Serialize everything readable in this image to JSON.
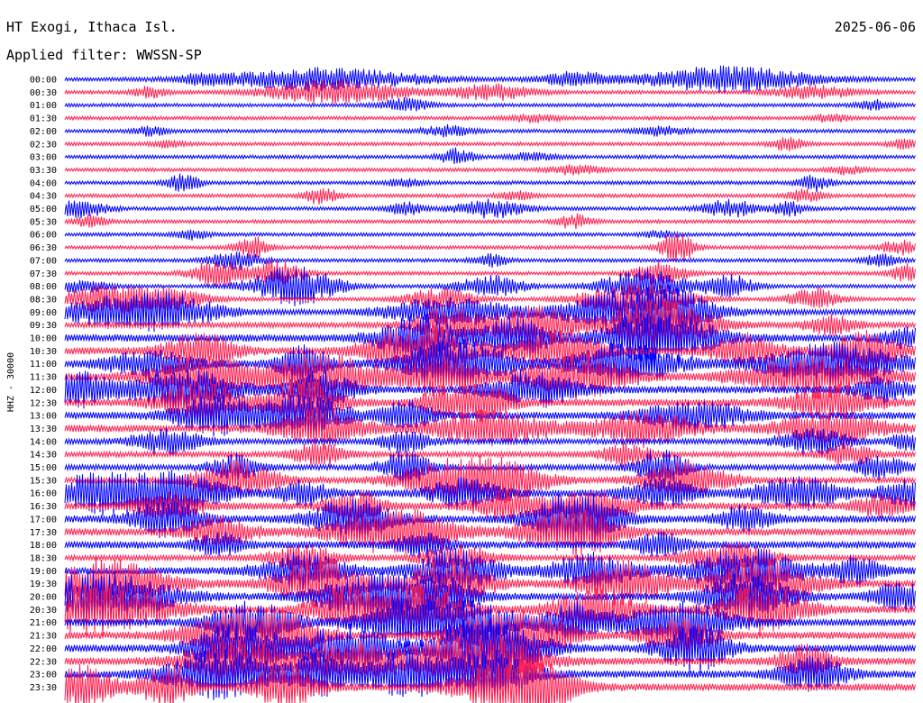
{
  "header": {
    "station": "HT Exogi, Ithaca Isl.",
    "date": "2025-06-06",
    "filter": "Applied filter: WWSSN-SP"
  },
  "chart_data": {
    "type": "line",
    "title": "HT Exogi, Ithaca Isl.",
    "subtitle": "Applied filter: WWSSN-SP",
    "date": "2025-06-06",
    "ylabel": "HHZ - 30000",
    "row_labels": [
      "00:00",
      "00:30",
      "01:00",
      "01:30",
      "02:00",
      "02:30",
      "03:00",
      "03:30",
      "04:00",
      "04:30",
      "05:00",
      "05:30",
      "06:00",
      "06:30",
      "07:00",
      "07:30",
      "08:00",
      "08:30",
      "09:00",
      "09:30",
      "10:00",
      "10:30",
      "11:00",
      "11:30",
      "12:00",
      "12:30",
      "13:00",
      "13:30",
      "14:00",
      "14:30",
      "15:00",
      "15:30",
      "16:00",
      "16:30",
      "17:00",
      "17:30",
      "18:00",
      "18:30",
      "19:00",
      "19:30",
      "20:00",
      "20:30",
      "21:00",
      "21:30",
      "22:00",
      "22:30",
      "23:00",
      "23:30"
    ],
    "row_colors": [
      "#0000ff",
      "#ff1e4f"
    ],
    "noise_level": [
      2,
      2,
      2,
      2,
      2,
      2,
      2,
      2,
      2,
      2,
      2,
      2,
      2,
      2,
      2,
      2,
      2,
      2,
      3,
      3,
      4,
      4,
      4,
      4,
      4,
      4,
      4,
      4,
      3,
      3,
      3,
      3,
      4,
      4,
      4,
      4,
      4,
      3,
      4,
      4,
      4,
      4,
      4,
      4,
      4,
      4,
      4,
      4
    ],
    "bursts": [
      [
        [
          0.3,
          0.12,
          12
        ],
        [
          0.6,
          0.04,
          8
        ],
        [
          0.78,
          0.1,
          14
        ],
        [
          0.16,
          0.02,
          5
        ]
      ],
      [
        [
          0.32,
          0.08,
          14
        ],
        [
          0.5,
          0.05,
          9
        ],
        [
          0.1,
          0.02,
          6
        ],
        [
          0.88,
          0.05,
          7
        ]
      ],
      [
        [
          0.4,
          0.03,
          7
        ],
        [
          0.95,
          0.02,
          5
        ]
      ],
      [
        [
          0.55,
          0.03,
          4
        ],
        [
          0.9,
          0.02,
          5
        ]
      ],
      [
        [
          0.1,
          0.02,
          5
        ],
        [
          0.45,
          0.03,
          6
        ],
        [
          0.7,
          0.03,
          5
        ]
      ],
      [
        [
          0.12,
          0.02,
          4
        ],
        [
          0.85,
          0.02,
          7
        ],
        [
          0.99,
          0.02,
          6
        ]
      ],
      [
        [
          0.46,
          0.02,
          9
        ],
        [
          0.55,
          0.03,
          4
        ]
      ],
      [
        [
          0.6,
          0.03,
          5
        ],
        [
          0.92,
          0.02,
          5
        ]
      ],
      [
        [
          0.14,
          0.02,
          9
        ],
        [
          0.88,
          0.02,
          9
        ],
        [
          0.4,
          0.02,
          4
        ]
      ],
      [
        [
          0.3,
          0.02,
          9
        ],
        [
          0.87,
          0.02,
          7
        ],
        [
          0.53,
          0.02,
          5
        ]
      ],
      [
        [
          0.02,
          0.03,
          10
        ],
        [
          0.4,
          0.02,
          7
        ],
        [
          0.5,
          0.04,
          10
        ],
        [
          0.78,
          0.03,
          10
        ],
        [
          0.85,
          0.02,
          8
        ]
      ],
      [
        [
          0.03,
          0.02,
          7
        ],
        [
          0.6,
          0.02,
          8
        ]
      ],
      [
        [
          0.15,
          0.02,
          5
        ],
        [
          0.7,
          0.02,
          4
        ]
      ],
      [
        [
          0.22,
          0.02,
          12
        ],
        [
          0.72,
          0.02,
          18
        ],
        [
          0.98,
          0.02,
          8
        ]
      ],
      [
        [
          0.2,
          0.03,
          10
        ],
        [
          0.5,
          0.02,
          7
        ],
        [
          0.96,
          0.02,
          7
        ]
      ],
      [
        [
          0.18,
          0.03,
          16
        ],
        [
          0.25,
          0.03,
          14
        ],
        [
          0.7,
          0.03,
          13
        ],
        [
          0.99,
          0.02,
          9
        ]
      ],
      [
        [
          0.02,
          0.03,
          7
        ],
        [
          0.27,
          0.05,
          22
        ],
        [
          0.5,
          0.04,
          12
        ],
        [
          0.68,
          0.05,
          18
        ],
        [
          0.78,
          0.03,
          13
        ]
      ],
      [
        [
          0.05,
          0.06,
          14
        ],
        [
          0.12,
          0.05,
          10
        ],
        [
          0.44,
          0.04,
          12
        ],
        [
          0.67,
          0.06,
          20
        ],
        [
          0.88,
          0.03,
          12
        ]
      ],
      [
        [
          0.05,
          0.06,
          14
        ],
        [
          0.12,
          0.06,
          18
        ],
        [
          0.45,
          0.07,
          16
        ],
        [
          0.67,
          0.08,
          24
        ],
        [
          0.72,
          0.04,
          12
        ]
      ],
      [
        [
          0.45,
          0.04,
          20
        ],
        [
          0.55,
          0.05,
          22
        ],
        [
          0.7,
          0.06,
          30
        ],
        [
          0.9,
          0.03,
          10
        ]
      ],
      [
        [
          0.42,
          0.05,
          24
        ],
        [
          0.53,
          0.04,
          22
        ],
        [
          0.7,
          0.06,
          32
        ],
        [
          0.99,
          0.03,
          10
        ]
      ],
      [
        [
          0.16,
          0.04,
          20
        ],
        [
          0.42,
          0.06,
          30
        ],
        [
          0.58,
          0.05,
          22
        ],
        [
          0.8,
          0.04,
          18
        ],
        [
          0.94,
          0.04,
          22
        ]
      ],
      [
        [
          0.1,
          0.05,
          14
        ],
        [
          0.28,
          0.03,
          20
        ],
        [
          0.46,
          0.06,
          26
        ],
        [
          0.66,
          0.06,
          22
        ],
        [
          0.9,
          0.08,
          22
        ]
      ],
      [
        [
          0.16,
          0.06,
          22
        ],
        [
          0.3,
          0.06,
          28
        ],
        [
          0.44,
          0.05,
          20
        ],
        [
          0.6,
          0.06,
          24
        ],
        [
          0.88,
          0.08,
          22
        ]
      ],
      [
        [
          0.02,
          0.04,
          18
        ],
        [
          0.14,
          0.06,
          22
        ],
        [
          0.3,
          0.04,
          20
        ],
        [
          0.55,
          0.05,
          20
        ],
        [
          0.96,
          0.03,
          14
        ]
      ],
      [
        [
          0.16,
          0.05,
          20
        ],
        [
          0.28,
          0.04,
          26
        ],
        [
          0.45,
          0.03,
          18
        ],
        [
          0.5,
          0.03,
          18
        ],
        [
          0.9,
          0.05,
          18
        ]
      ],
      [
        [
          0.18,
          0.05,
          20
        ],
        [
          0.28,
          0.05,
          22
        ],
        [
          0.4,
          0.03,
          16
        ],
        [
          0.74,
          0.06,
          16
        ]
      ],
      [
        [
          0.3,
          0.05,
          20
        ],
        [
          0.5,
          0.07,
          18
        ],
        [
          0.68,
          0.06,
          18
        ],
        [
          0.9,
          0.06,
          18
        ]
      ],
      [
        [
          0.12,
          0.04,
          14
        ],
        [
          0.4,
          0.03,
          12
        ],
        [
          0.88,
          0.04,
          14
        ],
        [
          0.99,
          0.02,
          9
        ]
      ],
      [
        [
          0.3,
          0.03,
          14
        ],
        [
          0.66,
          0.03,
          12
        ],
        [
          0.92,
          0.03,
          12
        ]
      ],
      [
        [
          0.2,
          0.03,
          14
        ],
        [
          0.4,
          0.03,
          18
        ],
        [
          0.7,
          0.03,
          20
        ],
        [
          0.96,
          0.03,
          12
        ]
      ],
      [
        [
          0.2,
          0.05,
          20
        ],
        [
          0.45,
          0.06,
          22
        ],
        [
          0.52,
          0.05,
          20
        ],
        [
          0.73,
          0.05,
          22
        ]
      ],
      [
        [
          0.05,
          0.07,
          22
        ],
        [
          0.14,
          0.05,
          20
        ],
        [
          0.28,
          0.03,
          12
        ],
        [
          0.47,
          0.04,
          16
        ],
        [
          0.7,
          0.04,
          16
        ],
        [
          0.86,
          0.05,
          18
        ],
        [
          0.99,
          0.03,
          14
        ]
      ],
      [
        [
          0.12,
          0.04,
          14
        ],
        [
          0.34,
          0.03,
          18
        ],
        [
          0.52,
          0.04,
          16
        ],
        [
          0.62,
          0.05,
          18
        ],
        [
          0.96,
          0.03,
          12
        ]
      ],
      [
        [
          0.12,
          0.04,
          20
        ],
        [
          0.34,
          0.05,
          22
        ],
        [
          0.58,
          0.04,
          18
        ],
        [
          0.62,
          0.04,
          20
        ],
        [
          0.8,
          0.03,
          14
        ]
      ],
      [
        [
          0.18,
          0.04,
          16
        ],
        [
          0.36,
          0.06,
          18
        ],
        [
          0.42,
          0.05,
          16
        ],
        [
          0.58,
          0.05,
          18
        ],
        [
          0.62,
          0.04,
          14
        ]
      ],
      [
        [
          0.18,
          0.03,
          12
        ],
        [
          0.42,
          0.03,
          12
        ],
        [
          0.7,
          0.03,
          12
        ]
      ],
      [
        [
          0.28,
          0.04,
          14
        ],
        [
          0.46,
          0.04,
          16
        ],
        [
          0.78,
          0.05,
          18
        ]
      ],
      [
        [
          0.28,
          0.05,
          18
        ],
        [
          0.46,
          0.05,
          22
        ],
        [
          0.62,
          0.05,
          18
        ],
        [
          0.8,
          0.06,
          26
        ],
        [
          0.93,
          0.03,
          14
        ]
      ],
      [
        [
          0.05,
          0.07,
          26
        ],
        [
          0.3,
          0.05,
          28
        ],
        [
          0.45,
          0.05,
          24
        ],
        [
          0.66,
          0.05,
          24
        ],
        [
          0.82,
          0.06,
          24
        ]
      ],
      [
        [
          0.04,
          0.08,
          28
        ],
        [
          0.36,
          0.06,
          24
        ],
        [
          0.44,
          0.04,
          22
        ],
        [
          0.8,
          0.05,
          24
        ],
        [
          0.98,
          0.03,
          16
        ]
      ],
      [
        [
          0.04,
          0.08,
          28
        ],
        [
          0.33,
          0.04,
          24
        ],
        [
          0.42,
          0.05,
          26
        ],
        [
          0.62,
          0.05,
          22
        ],
        [
          0.82,
          0.05,
          26
        ]
      ],
      [
        [
          0.22,
          0.05,
          22
        ],
        [
          0.4,
          0.05,
          24
        ],
        [
          0.48,
          0.05,
          22
        ],
        [
          0.6,
          0.04,
          20
        ],
        [
          0.72,
          0.06,
          24
        ]
      ],
      [
        [
          0.2,
          0.06,
          24
        ],
        [
          0.26,
          0.04,
          22
        ],
        [
          0.5,
          0.05,
          22
        ],
        [
          0.56,
          0.04,
          22
        ],
        [
          0.72,
          0.04,
          22
        ]
      ],
      [
        [
          0.2,
          0.05,
          26
        ],
        [
          0.33,
          0.06,
          24
        ],
        [
          0.47,
          0.04,
          22
        ],
        [
          0.52,
          0.05,
          24
        ],
        [
          0.74,
          0.04,
          26
        ]
      ],
      [
        [
          0.2,
          0.06,
          24
        ],
        [
          0.33,
          0.05,
          22
        ],
        [
          0.44,
          0.05,
          22
        ],
        [
          0.52,
          0.05,
          22
        ],
        [
          0.87,
          0.03,
          18
        ]
      ],
      [
        [
          0.18,
          0.06,
          26
        ],
        [
          0.3,
          0.04,
          22
        ],
        [
          0.4,
          0.05,
          24
        ],
        [
          0.5,
          0.05,
          24
        ],
        [
          0.88,
          0.04,
          18
        ]
      ],
      [
        [
          0.02,
          0.04,
          22
        ],
        [
          0.12,
          0.03,
          24
        ],
        [
          0.26,
          0.04,
          22
        ],
        [
          0.52,
          0.06,
          26
        ],
        [
          0.56,
          0.04,
          22
        ]
      ]
    ]
  }
}
